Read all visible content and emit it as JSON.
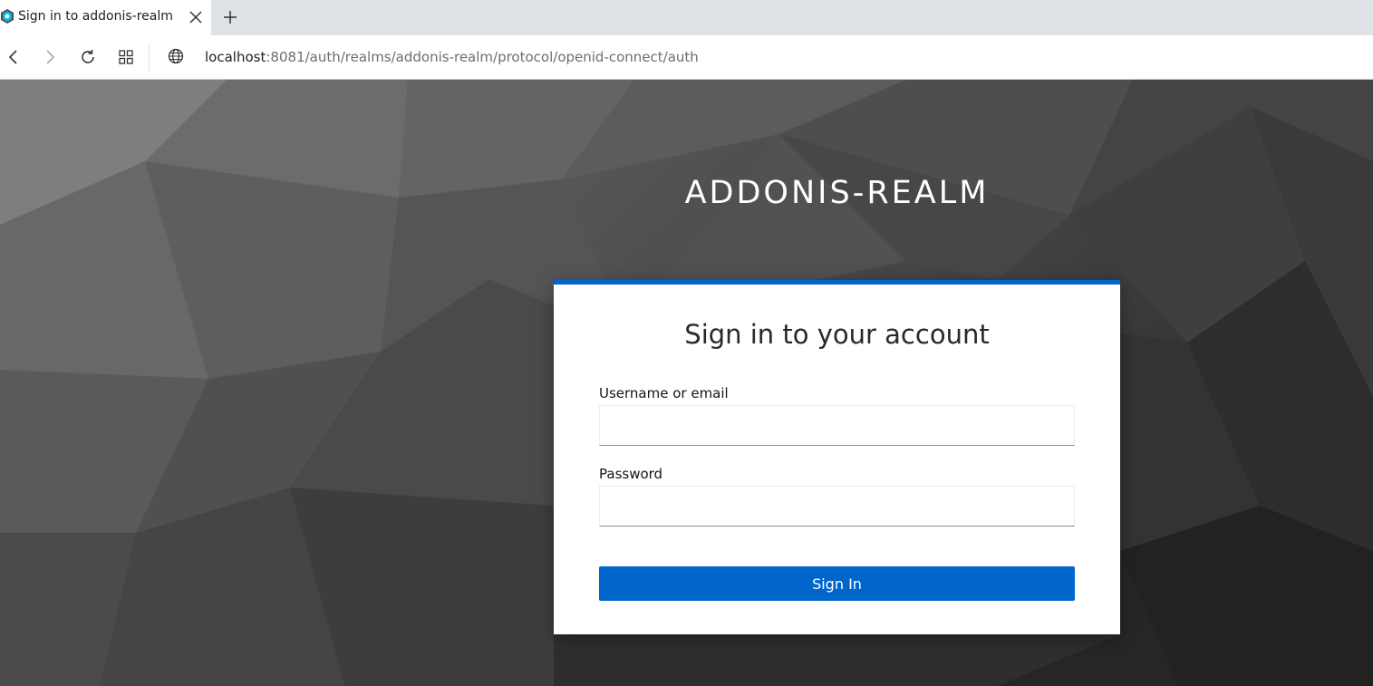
{
  "browser": {
    "tab": {
      "title": "Sign in to addonis-realm",
      "favicon": "keycloak-icon"
    },
    "icons": [
      "close-icon",
      "plus-icon",
      "back-arrow-icon",
      "forward-arrow-icon",
      "reload-icon",
      "apps-grid-icon",
      "globe-icon"
    ],
    "url": {
      "host": "localhost",
      "rest": ":8081/auth/realms/addonis-realm/protocol/openid-connect/auth"
    }
  },
  "page": {
    "realm_title": "ADDONIS-REALM",
    "card": {
      "title": "Sign in to your account",
      "username": {
        "label": "Username or email",
        "value": ""
      },
      "password": {
        "label": "Password",
        "value": ""
      },
      "submit_label": "Sign In"
    }
  },
  "colors": {
    "accent": "#0066cc",
    "card_background": "#ffffff",
    "page_background": "#3a3a3a"
  }
}
